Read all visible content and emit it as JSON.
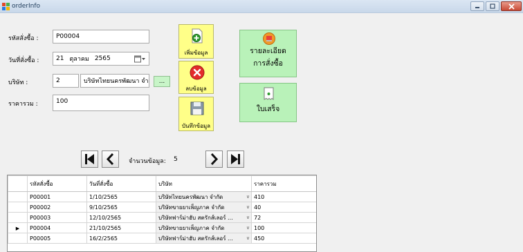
{
  "window": {
    "title": "orderInfo"
  },
  "form": {
    "order_id_label": "รหัสสั่งซื้อ :",
    "order_id_value": "P00004",
    "order_date_label": "วันที่สั่งซื้อ :",
    "order_date_day": "21",
    "order_date_month": "ตุลาคม",
    "order_date_year": "2565",
    "company_label": "บริษัท :",
    "company_id_value": "2",
    "company_name_value": "บริษัทไทยนครพัฒนา จำ",
    "browse_label": "...",
    "total_label": "ราคารวม :",
    "total_value": "100"
  },
  "actions": {
    "add_label": "เพิ่มข้อมูล",
    "delete_label": "ลบข้อมูล",
    "save_label": "บันทึกข้อมูล",
    "detail_label_line1": "รายละเอียด",
    "detail_label_line2": "การสั่งซื้อ",
    "receipt_label": "ใบเสร็จ"
  },
  "navigator": {
    "count_label": "จำนวนข้อมูล:",
    "count_value": "5"
  },
  "grid": {
    "columns": [
      "รหัสสั่งซื้อ",
      "วันที่สั่งซื้อ",
      "บริษัท",
      "ราคารวม"
    ],
    "rows": [
      {
        "order_id": "P00001",
        "date": "1/10/2565",
        "company": "บริษัทไทยนครพัฒนา จำกัด",
        "total": "410",
        "current": false
      },
      {
        "order_id": "P00002",
        "date": "9/10/2565",
        "company": "บริษัทขายยาเพ็ญภาค จำกัด",
        "total": "40",
        "current": false
      },
      {
        "order_id": "P00003",
        "date": "12/10/2565",
        "company": "บริษัทฟาร์ม่าฮับ สตรักส์เลอร์ ...",
        "total": "72",
        "current": false
      },
      {
        "order_id": "P00004",
        "date": "21/10/2565",
        "company": "บริษัทขายยาเพ็ญภาค จำกัด",
        "total": "100",
        "current": true
      },
      {
        "order_id": "P00005",
        "date": "16/2/2565",
        "company": "บริษัทฟาร์ม่าฮับ สตรักส์เลอร์ ...",
        "total": "450",
        "current": false
      }
    ]
  }
}
